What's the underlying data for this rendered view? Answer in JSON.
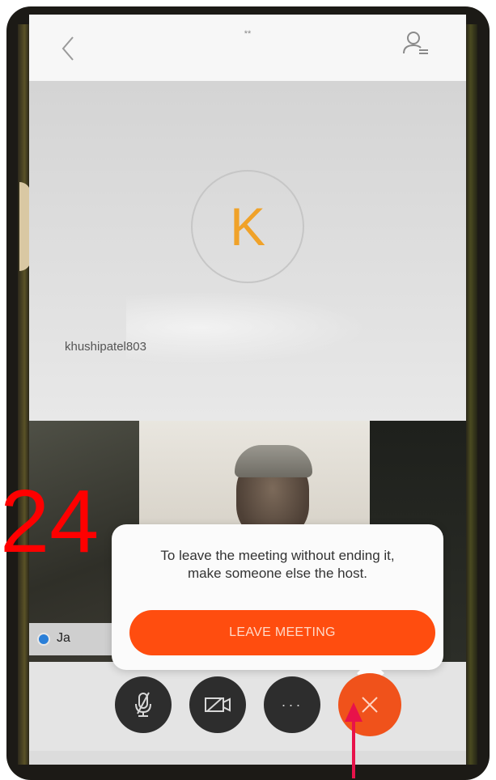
{
  "app": {
    "top_bar": {
      "title": "**"
    },
    "main_participant": {
      "initial": "K",
      "name": "khushipatel803"
    },
    "video_strip": {
      "name_chip": "Ja"
    },
    "leave_popover": {
      "message_line1": "To leave the meeting without ending it,",
      "message_line2": "make someone else the host.",
      "button_label": "LEAVE MEETING"
    },
    "controls": {
      "more_label": "···"
    }
  },
  "annotation": {
    "number": "24"
  },
  "colors": {
    "accent": "#ff4d0f",
    "end_button": "#f0521b",
    "avatar_letter": "#f0a229",
    "annotation": "#ff0000"
  },
  "icons": [
    "back-icon",
    "participants-icon",
    "mic-off-icon",
    "video-off-icon",
    "more-icon",
    "close-icon",
    "arrow-annotation"
  ]
}
